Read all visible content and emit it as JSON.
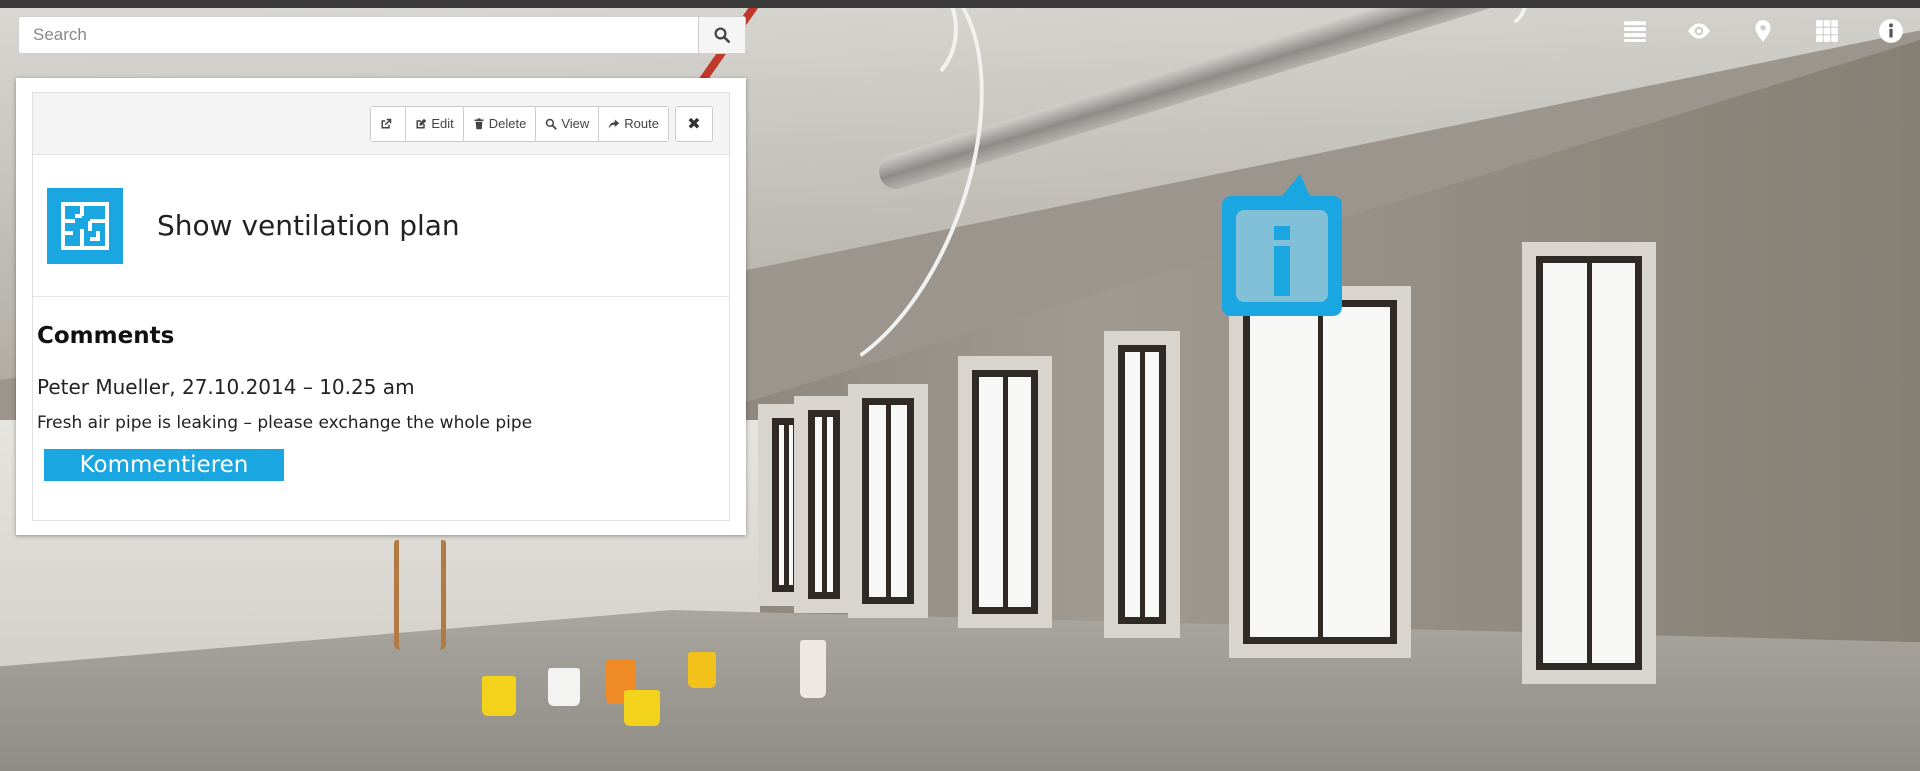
{
  "search": {
    "placeholder": "Search"
  },
  "toolbar": {
    "icons": [
      "list-icon",
      "eye-icon",
      "map-marker-icon",
      "grid-icon",
      "info-icon"
    ]
  },
  "popup": {
    "actions": {
      "open_label": "",
      "edit_label": "Edit",
      "delete_label": "Delete",
      "view_label": "View",
      "route_label": "Route",
      "close_label": "✖"
    },
    "plan": {
      "title": "Show ventilation plan",
      "icon": "floor-plan-icon"
    },
    "comments": {
      "heading": "Comments",
      "items": [
        {
          "author_line": "Peter Mueller, 27.10.2014 – 10.25 am",
          "text": "Fresh air pipe is leaking – please exchange the whole pipe"
        }
      ],
      "button_label": "Kommentieren"
    }
  },
  "hotspot": {
    "icon": "info-hotspot-icon"
  },
  "colors": {
    "accent": "#1aa6e0",
    "topbar": "#3a3a3a"
  }
}
